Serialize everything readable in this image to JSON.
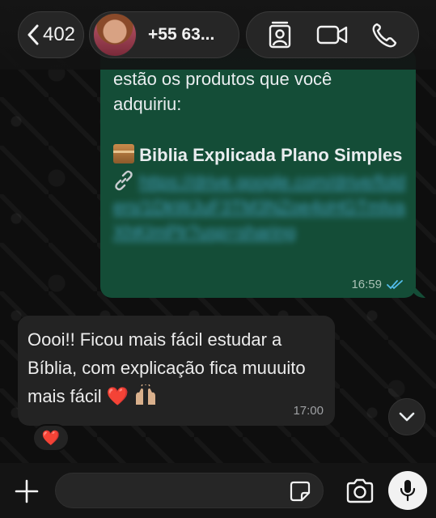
{
  "header": {
    "back_count": "402",
    "contact_name": "+55 63...",
    "icons": [
      "chevron-left-icon",
      "contact-card-icon",
      "video-call-icon",
      "phone-icon"
    ]
  },
  "messages": {
    "outgoing": {
      "line_partial": "estão os produtos que você",
      "line_2": "adquiriu:",
      "product_title": "Biblia Explicada Plano Simples",
      "link_blurred": "https://drive.google.com/drive/folders/1DkWJuF3TM3NZoe4oHGTmlvaXhKImPlr?usp=sharing",
      "time": "16:59",
      "status": "read"
    },
    "incoming": {
      "text": "Oooi!! Ficou mais fácil estudar a Bíblia, com explicação fica muuuito mais fácil",
      "heart_emoji": "❤️",
      "time": "17:00"
    },
    "reaction": "❤️"
  },
  "composer": {
    "placeholder": "",
    "icons": [
      "plus-icon",
      "sticker-icon",
      "camera-icon",
      "microphone-icon"
    ]
  },
  "colors": {
    "outgoing_bubble": "#144d37",
    "incoming_bubble": "#232323",
    "read_ticks": "#53bdeb"
  }
}
